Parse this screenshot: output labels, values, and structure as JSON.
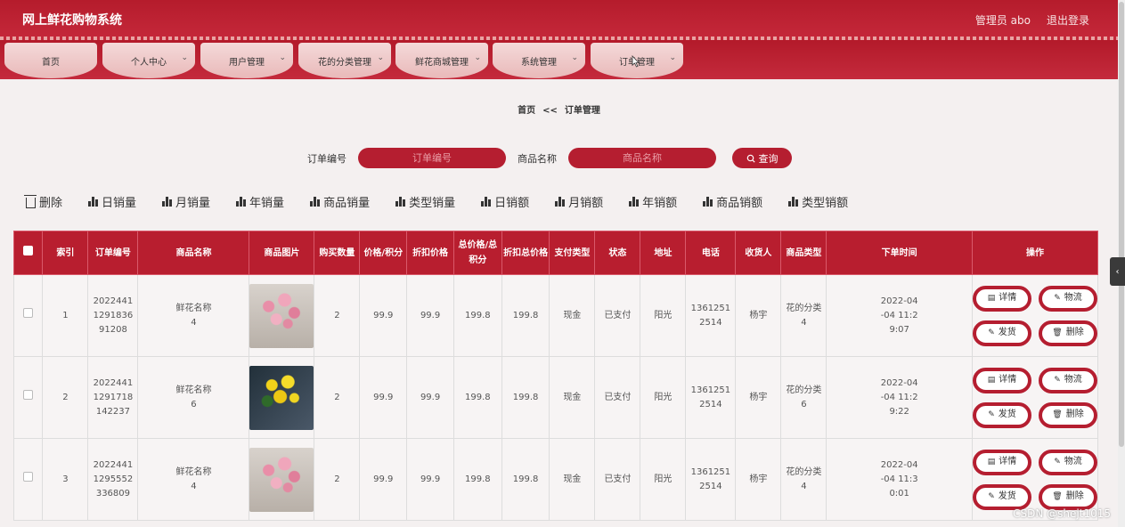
{
  "header": {
    "title": "网上鲜花购物系统",
    "user": "管理员 abo",
    "logout": "退出登录"
  },
  "nav": [
    {
      "label": "首页",
      "dropdown": false
    },
    {
      "label": "个人中心",
      "dropdown": true
    },
    {
      "label": "用户管理",
      "dropdown": true
    },
    {
      "label": "花的分类管理",
      "dropdown": true
    },
    {
      "label": "鲜花商城管理",
      "dropdown": true
    },
    {
      "label": "系统管理",
      "dropdown": true
    },
    {
      "label": "订单管理",
      "dropdown": true
    }
  ],
  "breadcrumb": {
    "home": "首页",
    "sep": "<<",
    "current": "订单管理"
  },
  "search": {
    "order_no_label": "订单编号",
    "order_no_placeholder": "订单编号",
    "product_label": "商品名称",
    "product_placeholder": "商品名称",
    "query_label": "查询"
  },
  "toolbar": {
    "delete": "删除",
    "items": [
      "日销量",
      "月销量",
      "年销量",
      "商品销量",
      "类型销量",
      "日销额",
      "月销额",
      "年销额",
      "商品销额",
      "类型销额"
    ]
  },
  "table": {
    "headers": [
      "索引",
      "订单编号",
      "商品名称",
      "商品图片",
      "购买数量",
      "价格/积分",
      "折扣价格",
      "总价格/总积分",
      "折扣总价格",
      "支付类型",
      "状态",
      "地址",
      "电话",
      "收货人",
      "商品类型",
      "下单时间",
      "操作"
    ],
    "rows": [
      {
        "index": "1",
        "order_no": "2022441129183691208",
        "name": "鲜花名称4",
        "image": "pink",
        "qty": "2",
        "price": "99.9",
        "discount": "99.9",
        "total": "199.8",
        "discount_total": "199.8",
        "pay": "现金",
        "status": "已支付",
        "address": "阳光",
        "phone": "13612512514",
        "receiver": "杨宇",
        "type": "花的分类4",
        "time": "2022-04-04 11:29:07"
      },
      {
        "index": "2",
        "order_no": "2022441129171814 2237",
        "name": "鲜花名称6",
        "image": "yellow",
        "qty": "2",
        "price": "99.9",
        "discount": "99.9",
        "total": "199.8",
        "discount_total": "199.8",
        "pay": "现金",
        "status": "已支付",
        "address": "阳光",
        "phone": "13612512514",
        "receiver": "杨宇",
        "type": "花的分类6",
        "time": "2022-04-04 11:29:22"
      },
      {
        "index": "3",
        "order_no": "2022441129555233 6809",
        "name": "鲜花名称4",
        "image": "pink",
        "qty": "2",
        "price": "99.9",
        "discount": "99.9",
        "total": "199.8",
        "discount_total": "199.8",
        "pay": "现金",
        "status": "已支付",
        "address": "阳光",
        "phone": "13612512514",
        "receiver": "杨宇",
        "type": "花的分类4",
        "time": "2022-04-04 11:30:01"
      }
    ],
    "row_display": [
      {
        "order_no": [
          "2022441",
          "1291836",
          "91208"
        ],
        "name": [
          "鲜花名称",
          "4"
        ],
        "phone": [
          "1361251",
          "2514"
        ],
        "type": [
          "花的分类",
          "4"
        ],
        "time": [
          "2022-04",
          "-04 11:2",
          "9:07"
        ]
      },
      {
        "order_no": [
          "2022441",
          "1291718",
          "142237"
        ],
        "name": [
          "鲜花名称",
          "6"
        ],
        "phone": [
          "1361251",
          "2514"
        ],
        "type": [
          "花的分类",
          "6"
        ],
        "time": [
          "2022-04",
          "-04 11:2",
          "9:22"
        ]
      },
      {
        "order_no": [
          "2022441",
          "1295552",
          "336809"
        ],
        "name": [
          "鲜花名称",
          "4"
        ],
        "phone": [
          "1361251",
          "2514"
        ],
        "type": [
          "花的分类",
          "4"
        ],
        "time": [
          "2022-04",
          "-04 11:3",
          "0:01"
        ]
      }
    ],
    "ops": {
      "detail": "详情",
      "logistics": "物流",
      "ship": "发货",
      "delete": "删除"
    }
  },
  "watermark": "CSDN @shejt1015",
  "colors": {
    "primary": "#b81e2f",
    "header": "#c5283a",
    "nav_tab": "#f0cfcf"
  }
}
